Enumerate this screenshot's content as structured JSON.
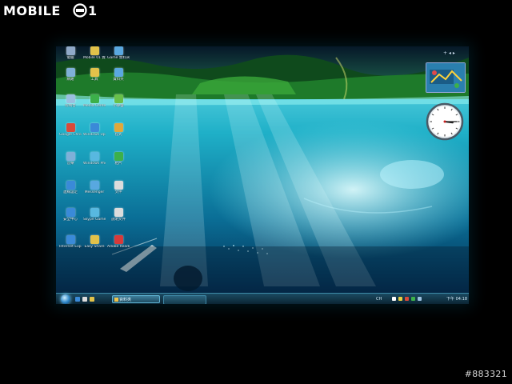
{
  "watermark": {
    "logo_text": "MOBILE01",
    "photo_id": "#883321"
  },
  "desktop": {
    "icons": [
      {
        "label": "電腦",
        "color": "#8fa9c8"
      },
      {
        "label": "Mobile 01 資料",
        "color": "#e2c24a"
      },
      {
        "label": "Game 資料夾",
        "color": "#5aa8e0"
      },
      {
        "label": "網路",
        "color": "#7fb0d8"
      },
      {
        "label": "工具",
        "color": "#e2c24a"
      },
      {
        "label": "資料夾",
        "color": "#5aa8e0"
      },
      {
        "label": "控制台",
        "color": "#9ac0e0"
      },
      {
        "label": "Media Center",
        "color": "#3cb04a"
      },
      {
        "label": "小算盤",
        "color": "#68c04a"
      },
      {
        "label": "Google Chrome",
        "color": "#d84a3a"
      },
      {
        "label": "Windows Update",
        "color": "#3a8ad8"
      },
      {
        "label": "程式",
        "color": "#e0a83a"
      },
      {
        "label": "音樂",
        "color": "#7fb0d8"
      },
      {
        "label": "Windows Photo Gallery",
        "color": "#58b8e0"
      },
      {
        "label": "相片",
        "color": "#3cb04a"
      },
      {
        "label": "連線設定",
        "color": "#3a8ad8"
      },
      {
        "label": "Messenger",
        "color": "#58a8e0"
      },
      {
        "label": "文件",
        "color": "#dcdcdc"
      },
      {
        "label": "安全中心",
        "color": "#3a8ad8"
      },
      {
        "label": "Skype Games",
        "color": "#58b8e0"
      },
      {
        "label": "說明文件",
        "color": "#dcdcdc"
      },
      {
        "label": "Internet Explorer",
        "color": "#3a8ad8"
      },
      {
        "label": "Easy Share",
        "color": "#e2c24a"
      },
      {
        "label": "Adobe Reader",
        "color": "#d83a3a"
      }
    ]
  },
  "taskbar": {
    "start_label": "Start",
    "active_window_label": "資料夾",
    "tray_language": "CH",
    "clock": "下午 04:18",
    "quicklaunch_colors": [
      "#3a8ad8",
      "#dcdcdc",
      "#e2c24a"
    ],
    "tray_icon_colors": [
      "#ffffff",
      "#e8d040",
      "#d84a3a",
      "#3cb04a",
      "#9ac0e0"
    ]
  },
  "gadgets": {
    "clock": {
      "hour": 3,
      "minute": 15
    },
    "photo": {
      "description_icon": "slideshow"
    }
  },
  "colors": {
    "water": "#1fb0c8",
    "jungle": "#1e7a2a",
    "taskbar": "#1b4a61"
  }
}
